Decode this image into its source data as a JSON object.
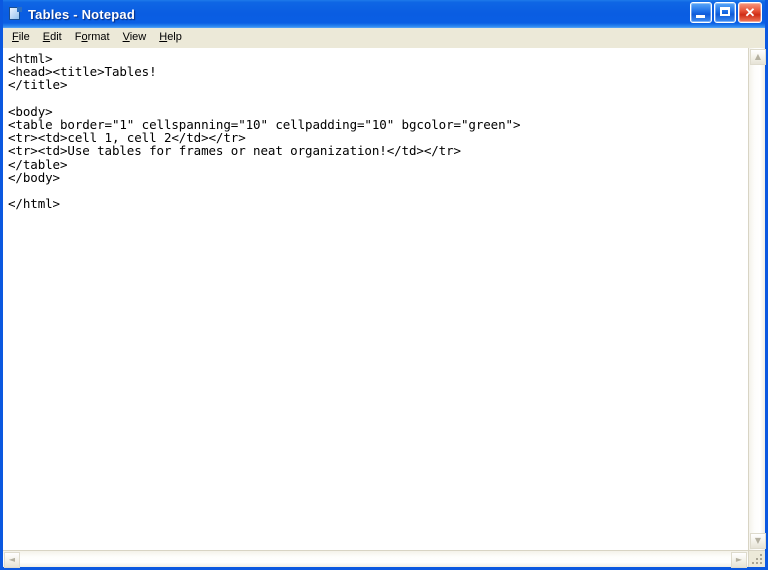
{
  "window": {
    "title": "Tables - Notepad",
    "icon": "notepad-document-icon",
    "frame_color": "#0b58e0",
    "titlebar_color": "#0a5de2",
    "close_button_color": "#cf2d16"
  },
  "title_buttons": {
    "minimize": {
      "name": "minimize-button",
      "glyph": "_"
    },
    "maximize": {
      "name": "maximize-button",
      "glyph": "□"
    },
    "close": {
      "name": "close-button",
      "glyph": "✕"
    }
  },
  "menu": {
    "items": [
      {
        "label": "File",
        "accel": "F"
      },
      {
        "label": "Edit",
        "accel": "E"
      },
      {
        "label": "Format",
        "accel": "o"
      },
      {
        "label": "View",
        "accel": "V"
      },
      {
        "label": "Help",
        "accel": "H"
      }
    ]
  },
  "editor": {
    "background": "#ffffff",
    "text_color": "#000000",
    "content": "<html>\n<head><title>Tables!\n</title>\n\n<body>\n<table border=\"1\" cellspanning=\"10\" cellpadding=\"10\" bgcolor=\"green\">\n<tr><td>cell 1, cell 2</td></tr>\n<tr><td>Use tables for frames or neat organization!</td></tr>\n</table>\n</body>\n\n</html>"
  },
  "scrollbars": {
    "vertical": {
      "up_arrow": "▲",
      "down_arrow": "▼",
      "state": "disabled"
    },
    "horizontal": {
      "left_arrow": "◄",
      "right_arrow": "►",
      "state": "disabled"
    },
    "resize_grip": "resize-grip"
  }
}
